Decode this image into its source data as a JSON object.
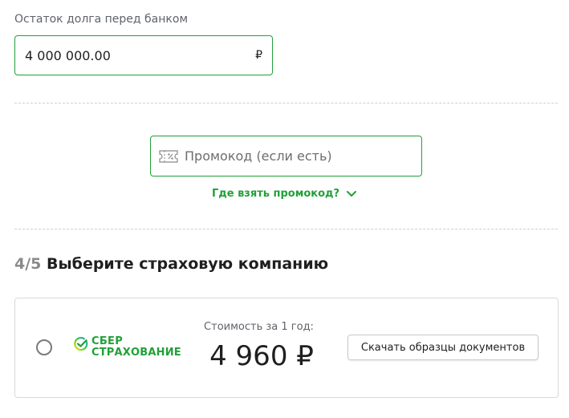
{
  "debt": {
    "label": "Остаток долга перед банком",
    "value": "4 000 000.00",
    "currency": "₽"
  },
  "promo": {
    "placeholder": "Промокод (если есть)",
    "icon": "promo-ticket-icon",
    "help_link": "Где взять промокод?"
  },
  "step": {
    "number": "4/5",
    "title": "Выберите страховую компанию"
  },
  "insurer": {
    "logo_line1": "СБЕР",
    "logo_line2": "СТРАХОВАНИЕ",
    "price_caption": "Стоимость за 1 год:",
    "price": "4 960 ₽",
    "download_label": "Скачать образцы документов",
    "selected": false
  },
  "colors": {
    "accent": "#21a038",
    "border": "#d9d9d9",
    "text": "#1f1f1f",
    "muted": "#5f6368"
  }
}
